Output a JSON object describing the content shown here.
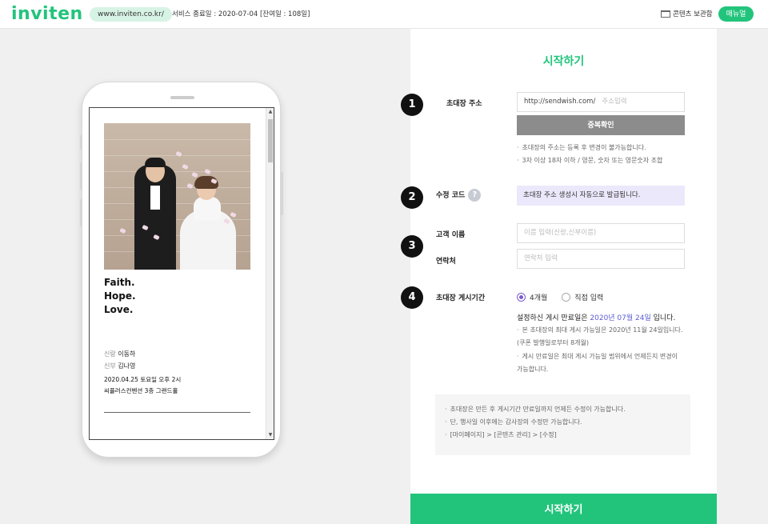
{
  "header": {
    "logo": "inviten",
    "url": "www.inviten.co.kr/",
    "service_end": "서비스 종료일 : 2020-07-04 [잔여일 : 108일]",
    "archive_label": "콘텐츠 보관함",
    "manual_label": "매뉴얼"
  },
  "preview": {
    "motto": [
      "Faith.",
      "Hope.",
      "Love."
    ],
    "groom_role": "신랑",
    "groom_name": "이동하",
    "bride_role": "신부",
    "bride_name": "김나영",
    "date_line": "2020.04.25 토요일 오후 2시",
    "venue_line": "씨플러스컨벤션 3층 그랜드홀"
  },
  "form": {
    "title": "시작하기",
    "steps": [
      "1",
      "2",
      "3",
      "4"
    ],
    "address": {
      "label": "초대장 주소",
      "prefix": "http://sendwish.com/",
      "placeholder": "주소입력",
      "check_button": "중복확인",
      "notes": [
        "초대장의 주소는 등록 후 변경이 불가능합니다.",
        "3자 이상 18자 이하 / 영문, 숫자 또는 영문숫자 조합"
      ]
    },
    "edit_code": {
      "label": "수정 코드",
      "help": "?",
      "value": "초대장 주소 생성시 자동으로 발급됩니다."
    },
    "customer": {
      "name_label": "고객 이름",
      "name_placeholder": "이름 입력(신랑,신부이름)",
      "contact_label": "연락처",
      "contact_placeholder": "연락처 입력"
    },
    "period": {
      "label": "초대장 게시기간",
      "options": [
        "4개월",
        "직접 입력"
      ],
      "selected": "4개월",
      "expiry_prefix": "설정하신 게시 만료일은 ",
      "expiry_date": "2020년 07월 24일",
      "expiry_suffix": " 입니다.",
      "notes": [
        "본 초대장의 최대 게시 가능일은 2020년 11월 24일입니다. (쿠폰 발행일로부터 8개월)",
        "게시 만료일은 최대 게시 가능일 범위에서 언제든지 변경이 가능합니다."
      ]
    },
    "info": [
      "초대장은 만든 후 게시기간 만료일까지 언제든 수정이 가능합니다.",
      "단, 행사일 이후에는 감사장의 수정만 가능합니다.",
      "[마이페이지] > [콘텐츠 관리] > [수정]"
    ],
    "start_button": "시작하기"
  },
  "colors": {
    "brand_green": "#22c47c",
    "accent_purple": "#7a5ccf",
    "highlight_blue": "#5b5bd6"
  }
}
